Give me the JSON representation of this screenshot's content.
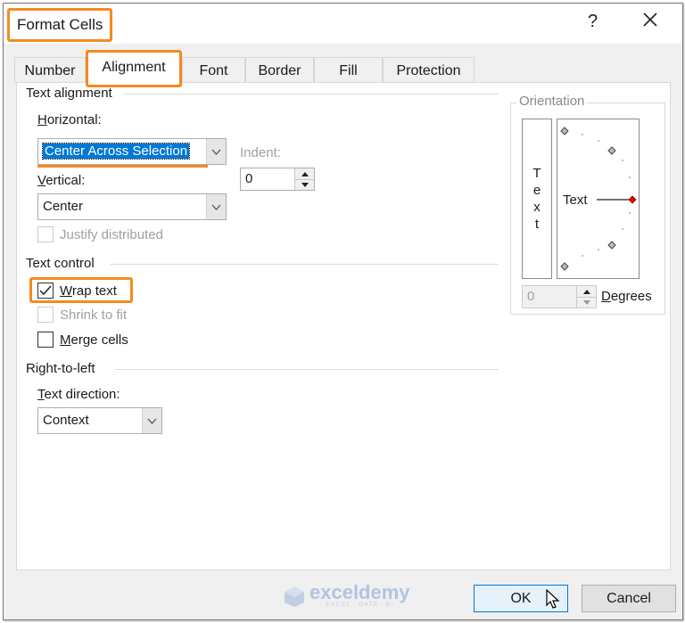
{
  "window": {
    "title": "Format Cells",
    "help_glyph": "?",
    "close_glyph": "✕"
  },
  "tabs": [
    {
      "label": "Number",
      "active": false
    },
    {
      "label": "Alignment",
      "active": true
    },
    {
      "label": "Font",
      "active": false
    },
    {
      "label": "Border",
      "active": false
    },
    {
      "label": "Fill",
      "active": false
    },
    {
      "label": "Protection",
      "active": false
    }
  ],
  "text_alignment": {
    "group_label": "Text alignment",
    "horizontal_label": "Horizontal:",
    "horizontal_value": "Center Across Selection",
    "vertical_label": "Vertical:",
    "vertical_value": "Center",
    "indent_label": "Indent:",
    "indent_value": "0",
    "justify_distributed_label": "Justify distributed",
    "justify_distributed_checked": false,
    "justify_distributed_enabled": false
  },
  "text_control": {
    "group_label": "Text control",
    "wrap_text_label": "Wrap text",
    "wrap_text_checked": true,
    "shrink_to_fit_label": "Shrink to fit",
    "shrink_to_fit_checked": false,
    "shrink_to_fit_enabled": false,
    "merge_cells_label": "Merge cells",
    "merge_cells_checked": false
  },
  "right_to_left": {
    "group_label": "Right-to-left",
    "text_direction_label": "Text direction:",
    "text_direction_value": "Context"
  },
  "orientation": {
    "group_label": "Orientation",
    "vertical_text": [
      "T",
      "e",
      "x",
      "t"
    ],
    "dial_text": "Text",
    "degrees_value": "0",
    "degrees_label": "Degrees",
    "selected_color": "#e00000"
  },
  "footer": {
    "watermark_name": "exceldemy",
    "watermark_tagline": "EXCEL · DATA · BI",
    "ok_label": "OK",
    "cancel_label": "Cancel"
  },
  "colors": {
    "highlight": "#f58a1f",
    "selection": "#0078d7"
  }
}
